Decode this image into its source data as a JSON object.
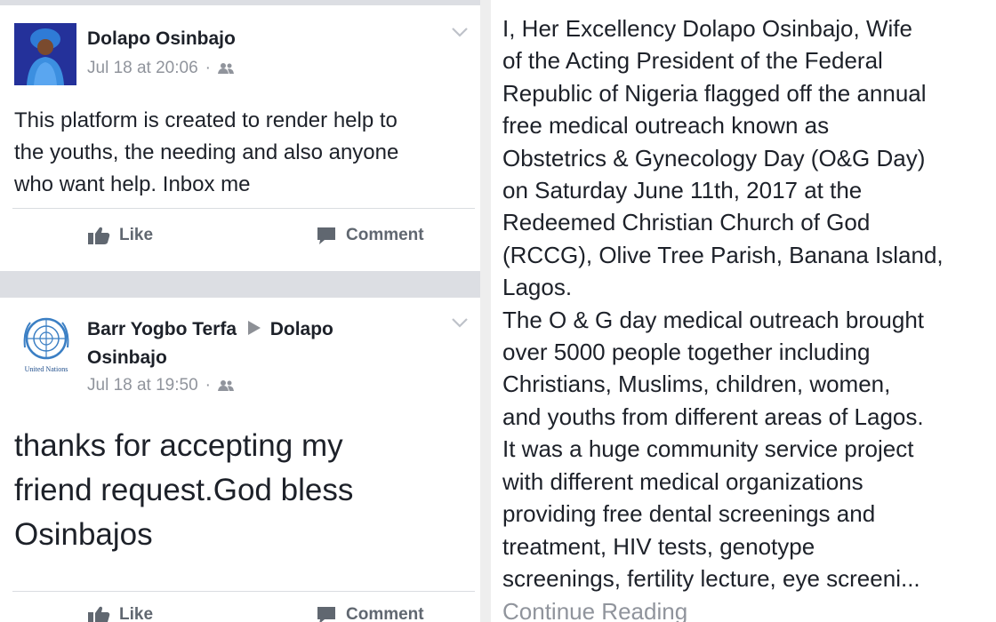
{
  "post1": {
    "author": "Dolapo Osinbajo",
    "timestamp": "Jul 18 at 20:06",
    "audience_icon": "friends-icon",
    "message": "This platform is created to render help to\nthe youths, the needing and also anyone\nwho want help. Inbox me",
    "like_label": "Like",
    "comment_label": "Comment"
  },
  "post2": {
    "author": "Barr Yogbo Terfa",
    "target": "Dolapo\nOsinbajo",
    "avatar_caption": "United Nations",
    "timestamp": "Jul 18 at 19:50",
    "audience_icon": "friends-icon",
    "message": "thanks for accepting my\nfriend request.God bless\nOsinbajos",
    "like_label": "Like",
    "comment_label": "Comment"
  },
  "article": {
    "text": "I, Her Excellency Dolapo Osinbajo, Wife\nof the Acting President of the Federal\nRepublic of Nigeria flagged off the annual\nfree medical outreach known as\nObstetrics & Gynecology Day (O&G Day)\non Saturday June 11th, 2017 at the\nRedeemed Christian Church of God\n(RCCG), Olive Tree Parish, Banana Island,\nLagos.\nThe O & G day medical outreach brought\nover 5000 people together including\nChristians, Muslims, children, women,\nand youths from different areas of Lagos.\nIt was a huge community service project\nwith different medical organizations\nproviding free dental screenings and\ntreatment, HIV tests, genotype\nscreenings, fertility lecture, eye screeni...",
    "continue_label": "Continue Reading"
  },
  "colors": {
    "text": "#1d2129",
    "meta": "#90949c",
    "action": "#606770",
    "band": "#dcdee3",
    "avatar_bg": "#24319a",
    "un_blue": "#3b7fc4"
  }
}
